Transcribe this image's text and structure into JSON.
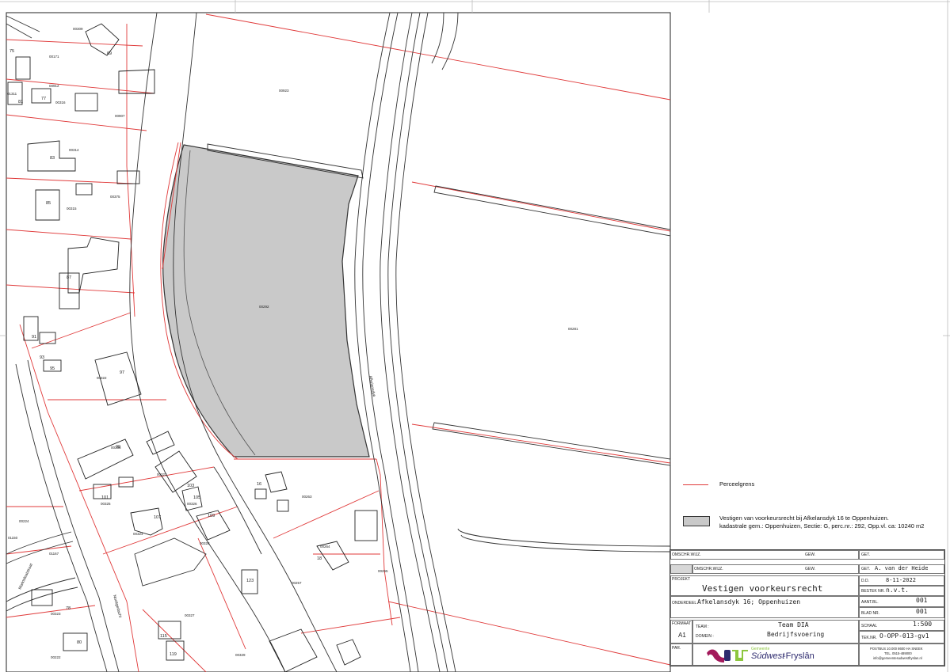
{
  "map": {
    "parcel_labels": [
      "00923",
      "00292",
      "00281",
      "00263",
      "00257",
      "00265",
      "00264",
      "00315",
      "00314",
      "00375",
      "00907",
      "00912",
      "00171",
      "00322",
      "00325",
      "00324",
      "00326",
      "00327",
      "00328",
      "00329",
      "00322",
      "00323",
      "00224",
      "00222",
      "01150",
      "01167",
      "00336",
      "00309",
      "00316",
      "01311"
    ],
    "house_numbers": [
      "69",
      "75",
      "77",
      "81",
      "83",
      "85",
      "87",
      "91",
      "93",
      "95",
      "97",
      "99",
      "101",
      "103",
      "105",
      "107",
      "109",
      "123",
      "78",
      "80",
      "115",
      "119",
      "16",
      "18"
    ],
    "street_labels": {
      "main": "Afkelansdyk",
      "west": "Nooitgedacht",
      "south_west": "Marktsleatstraat"
    }
  },
  "legend": {
    "items": [
      {
        "type": "line",
        "color": "#e03a3a",
        "label": "Perceelgrens"
      },
      {
        "type": "fill",
        "color": "#c9c9c9",
        "label_line1": "Vestigen van voorkeursrecht bij Afkelansdyk 16 te Oppenhuizen.",
        "label_line2": "kadastrale gem.: Oppenhuizen, Sectie: G, perc.nr.: 292, Opp.vl. ca: 10240 m2"
      }
    ]
  },
  "titleblock": {
    "row1": {
      "omschr_label": "OMSCHR.WIJZ.",
      "gew_label": "GEW.",
      "get_label": "GET."
    },
    "row2": {
      "omschr_label": "OMSCHR.WIJZ.",
      "gew_label": "GEW.",
      "get_label": "GET.",
      "get_value": "A. van der Heide"
    },
    "project_label": "PROJEKT",
    "project": "Vestigen voorkeursrecht",
    "dd_label": "D.D.",
    "dd": "8-11-2022",
    "bestek_label": "BESTEK NR.",
    "bestek": "n.v.t.",
    "onderdeel_label": "ONDERDEEL",
    "onderdeel": "Afkelansdyk 16; Oppenhuizen",
    "aant_label": "AANT.BL.",
    "aant": "001",
    "blad_label": "BLAD NR.",
    "blad": "001",
    "formaat_label": "FORMAAT",
    "formaat": "A1",
    "team_label": "TEAM :",
    "team": "Team DIA",
    "domein_label": "DOMEIN :",
    "domein": "Bedrijfsvoering",
    "schaal_label": "SCHAAL",
    "schaal": "1:500",
    "tek_label": "TEK.NR.",
    "tek": "O-OPP-013-gv1",
    "paf_label": "PAR.",
    "logo_small": "Gemeente",
    "logo_main": "Súdwest",
    "logo_sub": "-Fryslân",
    "address1": "POSTBUS 10.000  8600 HA  SNEEK",
    "address2": "TEL. 0515-489000",
    "address3": "info@gemeentesudwestfryslan.nl",
    "brand_colors": {
      "magenta": "#a3195b",
      "green": "#8dc63f",
      "navy": "#2d2a6e"
    }
  }
}
